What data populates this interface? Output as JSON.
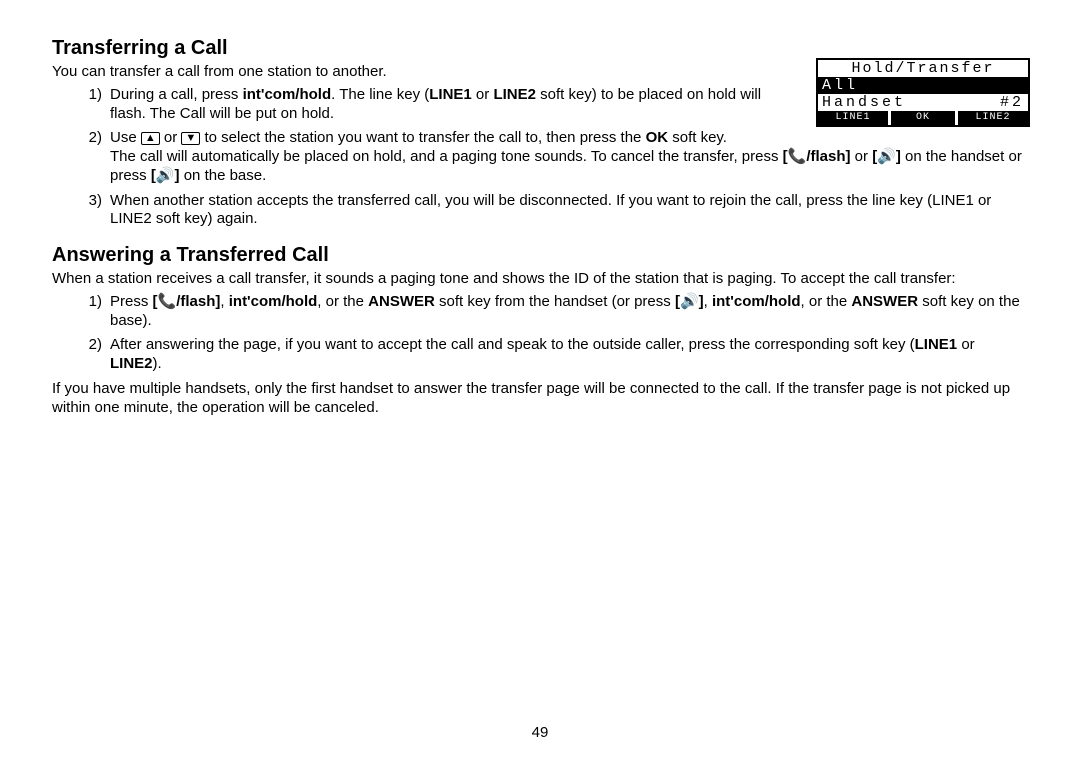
{
  "page_number": "49",
  "section1": {
    "heading": "Transferring a Call",
    "intro": "You can transfer a call from one station to another.",
    "items": [
      {
        "num": "1)",
        "text_pre": "During a call, press ",
        "b1": "int'com/hold",
        "text_mid": ". The line key (",
        "b2": "LINE1",
        "text_mid2": " or ",
        "b3": "LINE2",
        "text_after": " soft key) to be placed on hold will flash. The Call will be put on hold."
      },
      {
        "num": "2)",
        "text_a": "Use ",
        "icon_up": "▲",
        "text_b": " or ",
        "icon_down": "▼",
        "text_c": " to select the station you want to transfer the call to, then press the ",
        "b_ok": "OK",
        "text_d": " soft key.",
        "text_e": "The call will automatically be placed on hold, and a paging tone sounds. To cancel the transfer, press ",
        "icon_talk": "📞",
        "b_flash": "/flash",
        "text_f": " or ",
        "icon_spk1": "🔊",
        "text_g": " on the handset or press ",
        "icon_spk2": "🔊",
        "text_h": " on the base."
      },
      {
        "num": "3)",
        "text": "When another station accepts the transferred call, you will be disconnected. If you want to rejoin the call, press the line key (LINE1 or LINE2 soft key) again."
      }
    ]
  },
  "section2": {
    "heading": "Answering a Transferred Call",
    "intro": "When a station receives a call transfer, it sounds a paging tone and shows the ID of the station that is paging. To accept the call transfer:",
    "items": [
      {
        "num": "1)",
        "t1": "Press ",
        "icon_talk": "📞",
        "b_flash": "/flash",
        "t2": ", ",
        "b_int1": "int'com/hold",
        "t3": ", or the ",
        "b_ans1": "ANSWER",
        "t4": " soft key from the handset (or press ",
        "icon_spk": "🔊",
        "t5": ", ",
        "b_int2": "int'com/hold",
        "t6": ", or the ",
        "b_ans2": "ANSWER",
        "t7": " soft key on the base)."
      },
      {
        "num": "2)",
        "t1": "After answering the page, if you want to accept the call and speak to the outside caller, press the corresponding soft key (",
        "b1": "LINE1",
        "t2": " or ",
        "b2": "LINE2",
        "t3": ")."
      }
    ],
    "trailing": "If you have multiple handsets, only the first handset to answer the transfer page will be connected to the call. If the transfer page is not picked up within one minute, the operation will be canceled."
  },
  "lcd": {
    "title": "Hold/Transfer",
    "row2": "All",
    "row3_left": "Handset",
    "row3_right": "#2",
    "sk1": "LINE1",
    "sk2": "OK",
    "sk3": "LINE2"
  }
}
